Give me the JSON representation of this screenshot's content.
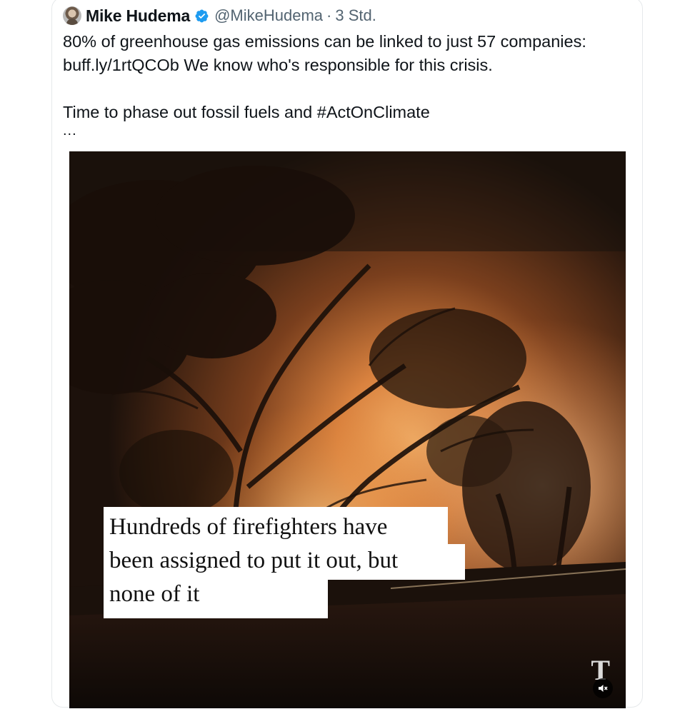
{
  "tweet": {
    "author": {
      "display_name": "Mike Hudema",
      "handle": "@MikeHudema",
      "verified": true,
      "avatar_icon": "avatar-icon"
    },
    "separator": "·",
    "time": "3 Std.",
    "text": {
      "line1": "80% of greenhouse gas emissions can be linked to just 57 companies:",
      "link": "buff.ly/1rtQCOb",
      "line2_rest": " We know who's responsible for this crisis.",
      "line3_before": "Time to phase out fossil fuels and ",
      "hashtag": "#ActOnClimate"
    },
    "more": "..."
  },
  "media": {
    "type": "video",
    "caption_lines": [
      "Hundreds of firefighters have",
      "been assigned to put it out, but",
      "none of it"
    ],
    "watermark": "T",
    "mute_icon": "volume-muted-icon"
  },
  "colors": {
    "text": "#0f1419",
    "secondary": "#536471",
    "verified": "#1d9bf0",
    "border": "#e6e9eb"
  }
}
